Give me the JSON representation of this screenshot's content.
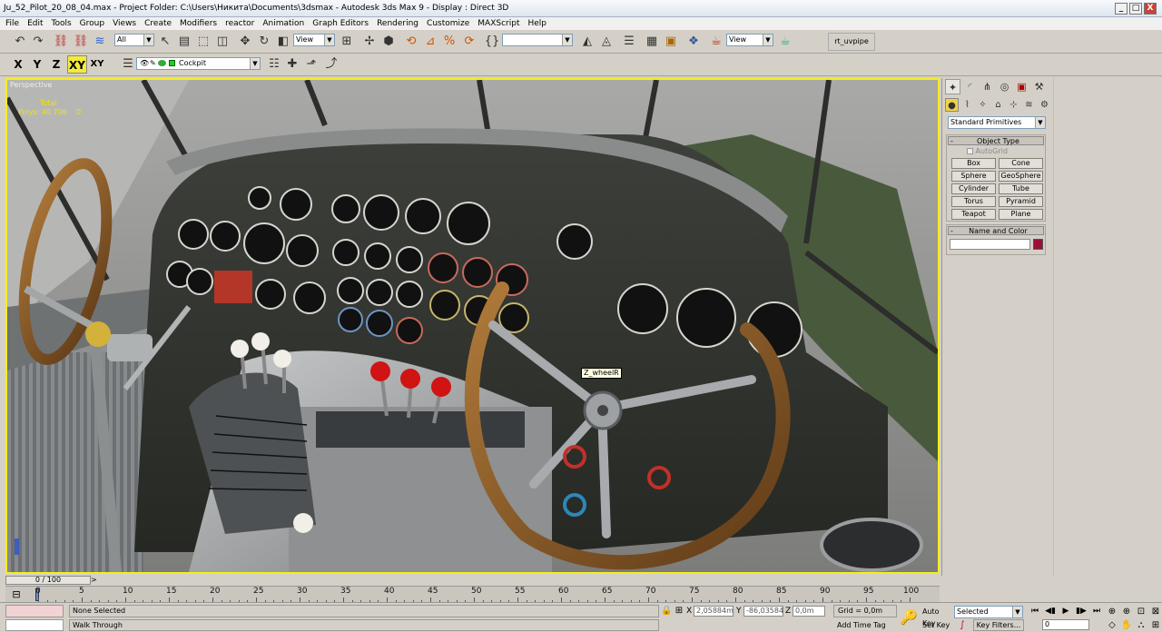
{
  "window": {
    "title": "Ju_52_Pilot_20_08_04.max   - Project Folder: C:\\Users\\Никита\\Documents\\3dsmax    - Autodesk 3ds Max 9    - Display : Direct 3D",
    "min": "_",
    "max": "□",
    "close": "X"
  },
  "menu": [
    "File",
    "Edit",
    "Tools",
    "Group",
    "Views",
    "Create",
    "Modifiers",
    "reactor",
    "Animation",
    "Graph Editors",
    "Rendering",
    "Customize",
    "MAXScript",
    "Help"
  ],
  "toolbar": {
    "selection_filter": "All",
    "ref_coord": "View",
    "named_sel": "",
    "ref_coord2": "View",
    "rt_label": "rt_uvpipe"
  },
  "axis": {
    "x": "X",
    "y": "Y",
    "z": "Z",
    "xy": "XY",
    "xyz": "XY"
  },
  "layer": {
    "name": "Cockpit"
  },
  "viewport": {
    "label": "Perspective",
    "stats_header": "Total",
    "stats_label": "Polys:",
    "stats_value": "40 706",
    "stats_sel": "0",
    "tooltip": "Z_wheelR"
  },
  "panel": {
    "category": "Standard Primitives",
    "object_type_header": "Object Type",
    "autogrid": "AutoGrid",
    "buttons": [
      "Box",
      "Cone",
      "Sphere",
      "GeoSphere",
      "Cylinder",
      "Tube",
      "Torus",
      "Pyramid",
      "Teapot",
      "Plane"
    ],
    "name_color_header": "Name and Color",
    "object_color": "#9b1039"
  },
  "timeline": {
    "frame": "0 / 100",
    "ticks": [
      "0",
      "5",
      "10",
      "15",
      "20",
      "25",
      "30",
      "35",
      "40",
      "45",
      "50",
      "55",
      "60",
      "65",
      "70",
      "75",
      "80",
      "85",
      "90",
      "95",
      "100"
    ]
  },
  "status": {
    "selection": "None Selected",
    "prompt": "Walk Through",
    "x_label": "X",
    "x_value": "2,05884m",
    "y_label": "Y",
    "y_value": "-86,03584",
    "z_label": "Z",
    "z_value": "0,0m",
    "grid": "Grid = 0,0m",
    "add_time_tag": "Add Time Tag",
    "auto_key": "Auto Key",
    "set_key": "Set Key",
    "key_mode": "Selected",
    "key_filters": "Key Filters...",
    "current_frame": "0"
  }
}
